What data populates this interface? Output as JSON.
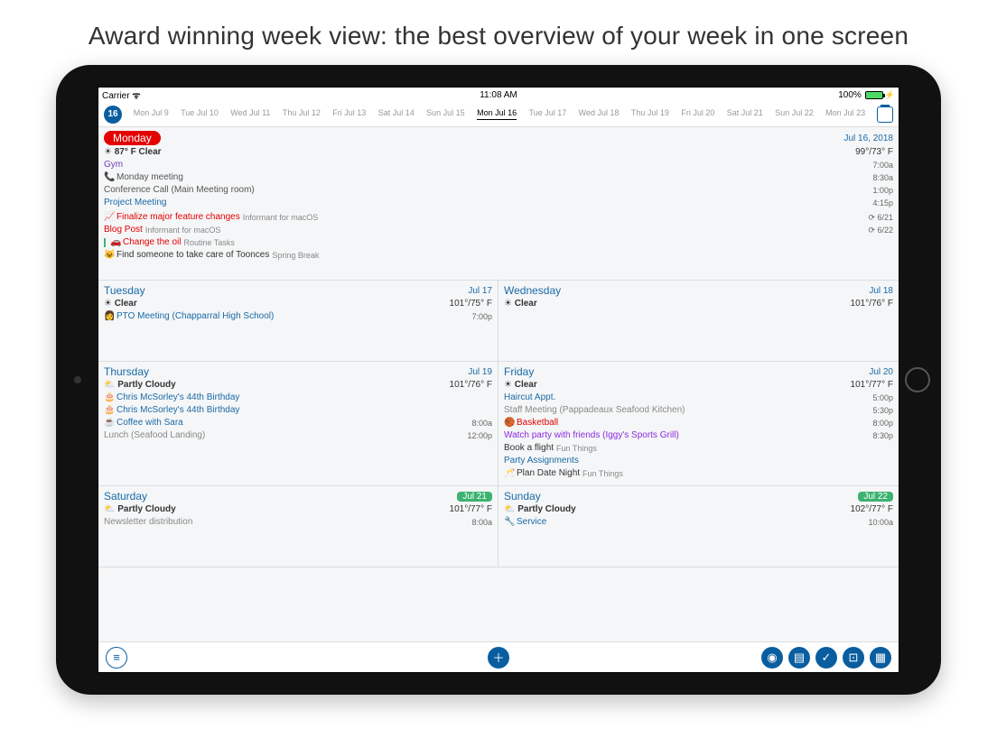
{
  "headline": "Award winning week view: the best overview of your week in one screen",
  "status": {
    "carrier": "Carrier",
    "time": "11:08 AM",
    "battery": "100%"
  },
  "topbar": {
    "day_number": "16",
    "tabs": [
      {
        "d": "Mon",
        "dt": "Jul 9"
      },
      {
        "d": "Tue",
        "dt": "Jul 10"
      },
      {
        "d": "Wed",
        "dt": "Jul 11"
      },
      {
        "d": "Thu",
        "dt": "Jul 12"
      },
      {
        "d": "Fri",
        "dt": "Jul 13"
      },
      {
        "d": "Sat",
        "dt": "Jul 14"
      },
      {
        "d": "Sun",
        "dt": "Jul 15"
      },
      {
        "d": "Mon",
        "dt": "Jul 16",
        "active": true
      },
      {
        "d": "Tue",
        "dt": "Jul 17"
      },
      {
        "d": "Wed",
        "dt": "Jul 18"
      },
      {
        "d": "Thu",
        "dt": "Jul 19"
      },
      {
        "d": "Fri",
        "dt": "Jul 20"
      },
      {
        "d": "Sat",
        "dt": "Jul 21"
      },
      {
        "d": "Sun",
        "dt": "Jul 22"
      },
      {
        "d": "Mon",
        "dt": "Jul 23"
      }
    ]
  },
  "monday": {
    "label": "Monday",
    "date": "Jul 16, 2018",
    "weather_left": "87° F Clear",
    "weather_right": "99°/73° F",
    "events": [
      {
        "text": "Gym",
        "time": "7:00a",
        "color": "#6a3fb5"
      },
      {
        "icon": "📞",
        "text": "Monday meeting",
        "time": "8:30a",
        "color": "#555"
      },
      {
        "text": "Conference Call (Main Meeting room)",
        "time": "1:00p",
        "color": "#555"
      },
      {
        "text": "Project Meeting",
        "time": "4:15p",
        "color": "#1a6aa7"
      }
    ],
    "tasks": [
      {
        "icon": "📈",
        "text": "Finalize major feature changes",
        "tag": "Informant for macOS",
        "color": "#e30000",
        "meta": "6/21"
      },
      {
        "text": "Blog Post",
        "tag": "Informant for macOS",
        "color": "#e30000",
        "meta": "6/22"
      },
      {
        "icon": "🚗",
        "text": "Change the oil",
        "tag": "Routine Tasks",
        "color": "#e30000",
        "bar": "#3cb371"
      },
      {
        "icon": "😺",
        "text": "Find someone to take care of Toonces",
        "tag": "Spring Break",
        "color": "#333"
      }
    ]
  },
  "tuesday": {
    "name": "Tuesday",
    "date": "Jul 17",
    "weather": "Clear",
    "temps": "101°/75° F",
    "events": [
      {
        "icon": "👩",
        "text": "PTO Meeting (Chapparral High School)",
        "time": "7:00p",
        "color": "#1a6aa7"
      }
    ]
  },
  "wednesday": {
    "name": "Wednesday",
    "date": "Jul 18",
    "weather": "Clear",
    "temps": "101°/76° F",
    "events": []
  },
  "thursday": {
    "name": "Thursday",
    "date": "Jul 19",
    "weather": "Partly Cloudy",
    "temps": "101°/76° F",
    "events": [
      {
        "icon": "🎂",
        "text": "Chris McSorley's 44th Birthday",
        "color": "#1a6aa7"
      },
      {
        "icon": "🎂",
        "text": "Chris McSorley's 44th Birthday",
        "color": "#1a6aa7"
      },
      {
        "icon": "☕",
        "text": "Coffee with Sara",
        "time": "8:00a",
        "color": "#1a6aa7"
      },
      {
        "text": "Lunch (Seafood Landing)",
        "time": "12:00p",
        "color": "#888"
      }
    ]
  },
  "friday": {
    "name": "Friday",
    "date": "Jul 20",
    "weather": "Clear",
    "temps": "101°/77° F",
    "events": [
      {
        "text": "Haircut Appt.",
        "time": "5:00p",
        "color": "#1a6aa7"
      },
      {
        "text": "Staff Meeting (Pappadeaux Seafood Kitchen)",
        "time": "5:30p",
        "color": "#888"
      },
      {
        "icon": "🏀",
        "text": "Basketball",
        "time": "8:00p",
        "color": "#e30000"
      },
      {
        "text": "Watch party with friends (Iggy's Sports Grill)",
        "time": "8:30p",
        "color": "#8a2be2"
      },
      {
        "text": "Book a flight",
        "tag": "Fun Things",
        "color": "#333"
      },
      {
        "text": "Party Assignments",
        "color": "#1a6aa7"
      },
      {
        "icon": "🥂",
        "text": "Plan Date Night",
        "tag": "Fun Things",
        "color": "#333"
      }
    ]
  },
  "saturday": {
    "name": "Saturday",
    "date": "Jul 21",
    "weather": "Partly Cloudy",
    "temps": "101°/77° F",
    "badge": true,
    "events": [
      {
        "text": "Newsletter distribution",
        "time": "8:00a",
        "color": "#888"
      }
    ]
  },
  "sunday": {
    "name": "Sunday",
    "date": "Jul 22",
    "weather": "Partly Cloudy",
    "temps": "102°/77° F",
    "badge": true,
    "events": [
      {
        "icon": "🔧",
        "text": "Service",
        "time": "10:00a",
        "color": "#1a6aa7"
      }
    ]
  }
}
